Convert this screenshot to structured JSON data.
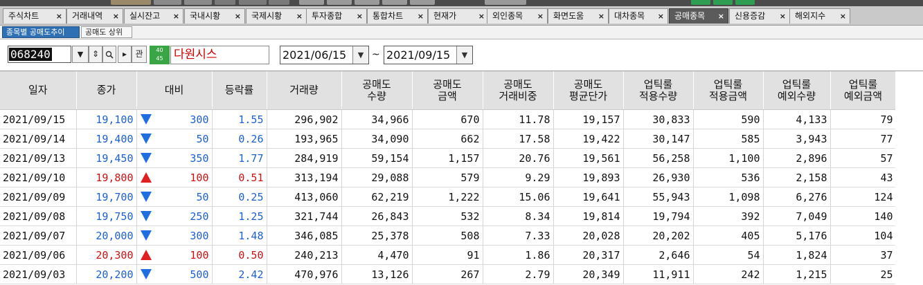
{
  "tabs": [
    {
      "label": "주식차트"
    },
    {
      "label": "거래내역"
    },
    {
      "label": "실시잔고"
    },
    {
      "label": "국내시황"
    },
    {
      "label": "국제시황"
    },
    {
      "label": "투자종합"
    },
    {
      "label": "통합차트"
    },
    {
      "label": "현재가"
    },
    {
      "label": "외인종목"
    },
    {
      "label": "화면도움"
    },
    {
      "label": "대차종목"
    },
    {
      "label": "공매종목",
      "active": true
    },
    {
      "label": "신용증감"
    },
    {
      "label": "해외지수"
    }
  ],
  "tab_close": "×",
  "subtabs": [
    {
      "label": "종목별 공매도추이",
      "active": true
    },
    {
      "label": "공매도 상위"
    }
  ],
  "toolbar": {
    "stock_code": "068240",
    "btn_down": "▼",
    "btn_updown": "⇕",
    "btn_search": "🔍",
    "btn_next": "▸",
    "btn_interest": "관",
    "badge_top": "40",
    "badge_bottom": "45",
    "stock_name": "다원시스",
    "date_from": "2021/06/15",
    "date_to": "2021/09/15",
    "date_sep": "~",
    "dropdown": "▼"
  },
  "table": {
    "headers": [
      [
        "일자"
      ],
      [
        "종가"
      ],
      [
        "대비"
      ],
      [
        "등락률"
      ],
      [
        "거래량"
      ],
      [
        "공매도",
        "수량"
      ],
      [
        "공매도",
        "금액"
      ],
      [
        "공매도",
        "거래비중"
      ],
      [
        "공매도",
        "평균단가"
      ],
      [
        "업틱룰",
        "적용수량"
      ],
      [
        "업틱룰",
        "적용금액"
      ],
      [
        "업틱룰",
        "예외수량"
      ],
      [
        "업틱룰",
        "예외금액"
      ]
    ],
    "rows": [
      {
        "date": "2021/09/15",
        "close": "19,100",
        "dir": "down",
        "change": "300",
        "rate": "1.55",
        "volume": "296,902",
        "sqty": "34,966",
        "samt": "670",
        "sratio": "11.78",
        "savg": "19,157",
        "uqty": "30,833",
        "uamt": "590",
        "eqty": "4,133",
        "eamt": "79"
      },
      {
        "date": "2021/09/14",
        "close": "19,400",
        "dir": "down",
        "change": "50",
        "rate": "0.26",
        "volume": "193,965",
        "sqty": "34,090",
        "samt": "662",
        "sratio": "17.58",
        "savg": "19,422",
        "uqty": "30,147",
        "uamt": "585",
        "eqty": "3,943",
        "eamt": "77"
      },
      {
        "date": "2021/09/13",
        "close": "19,450",
        "dir": "down",
        "change": "350",
        "rate": "1.77",
        "volume": "284,919",
        "sqty": "59,154",
        "samt": "1,157",
        "sratio": "20.76",
        "savg": "19,561",
        "uqty": "56,258",
        "uamt": "1,100",
        "eqty": "2,896",
        "eamt": "57"
      },
      {
        "date": "2021/09/10",
        "close": "19,800",
        "dir": "up",
        "change": "100",
        "rate": "0.51",
        "volume": "313,194",
        "sqty": "29,088",
        "samt": "579",
        "sratio": "9.29",
        "savg": "19,893",
        "uqty": "26,930",
        "uamt": "536",
        "eqty": "2,158",
        "eamt": "43"
      },
      {
        "date": "2021/09/09",
        "close": "19,700",
        "dir": "down",
        "change": "50",
        "rate": "0.25",
        "volume": "413,060",
        "sqty": "62,219",
        "samt": "1,222",
        "sratio": "15.06",
        "savg": "19,641",
        "uqty": "55,943",
        "uamt": "1,098",
        "eqty": "6,276",
        "eamt": "124"
      },
      {
        "date": "2021/09/08",
        "close": "19,750",
        "dir": "down",
        "change": "250",
        "rate": "1.25",
        "volume": "321,744",
        "sqty": "26,843",
        "samt": "532",
        "sratio": "8.34",
        "savg": "19,814",
        "uqty": "19,794",
        "uamt": "392",
        "eqty": "7,049",
        "eamt": "140"
      },
      {
        "date": "2021/09/07",
        "close": "20,000",
        "dir": "down",
        "change": "300",
        "rate": "1.48",
        "volume": "346,085",
        "sqty": "25,378",
        "samt": "508",
        "sratio": "7.33",
        "savg": "20,028",
        "uqty": "20,202",
        "uamt": "405",
        "eqty": "5,176",
        "eamt": "104"
      },
      {
        "date": "2021/09/06",
        "close": "20,300",
        "dir": "up",
        "change": "100",
        "rate": "0.50",
        "volume": "240,213",
        "sqty": "4,470",
        "samt": "91",
        "sratio": "1.86",
        "savg": "20,317",
        "uqty": "2,646",
        "uamt": "54",
        "eqty": "1,824",
        "eamt": "37"
      },
      {
        "date": "2021/09/03",
        "close": "20,200",
        "dir": "down",
        "change": "500",
        "rate": "2.42",
        "volume": "470,976",
        "sqty": "13,126",
        "samt": "267",
        "sratio": "2.79",
        "savg": "20,349",
        "uqty": "11,911",
        "uamt": "242",
        "eqty": "1,215",
        "eamt": "25"
      }
    ]
  },
  "colors": {
    "up": "#d01010",
    "down": "#1a5fd6",
    "active_tab": "#5b5b5b",
    "header_bg": "#e1e1e1",
    "stock_name": "#d00000"
  }
}
